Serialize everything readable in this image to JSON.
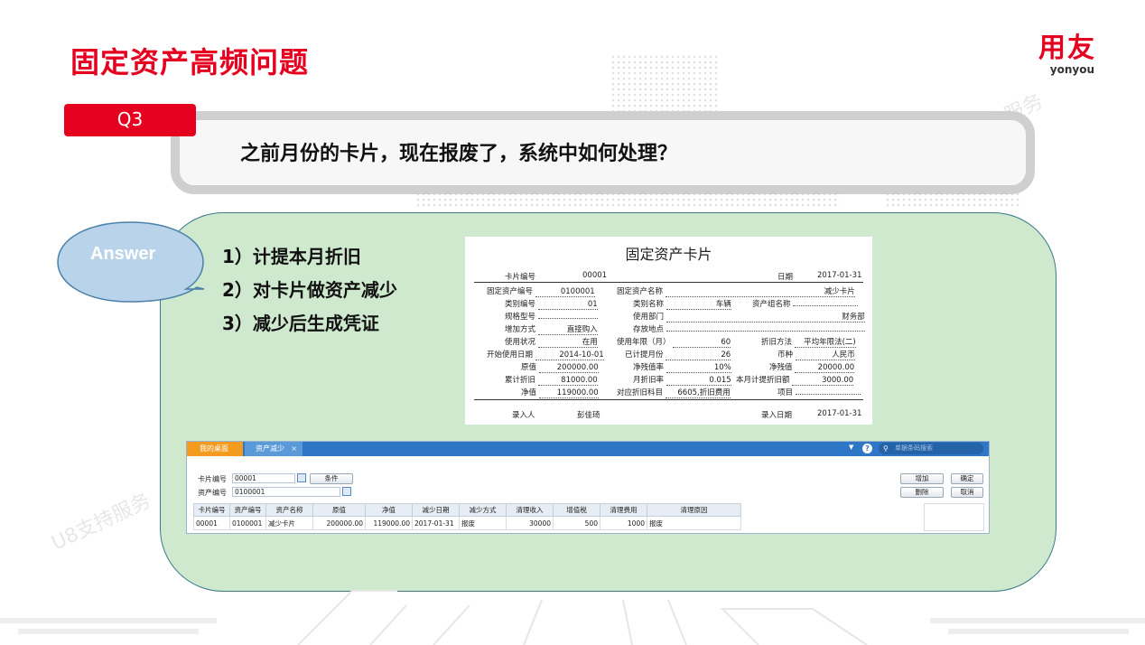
{
  "slide": {
    "title": "固定资产高频问题"
  },
  "logo": {
    "cn": "用友",
    "en": "yonyou"
  },
  "watermarks": [
    "U8支持服务",
    "U8支持服务",
    "U8支持服务"
  ],
  "question": {
    "tag": "Q3",
    "text": "之前月份的卡片，现在报废了，系统中如何处理？"
  },
  "answer": {
    "label": "Answer",
    "steps": [
      "1）计提本月折旧",
      "2）对卡片做资产减少",
      "3）减少后生成凭证"
    ]
  },
  "card": {
    "title": "固定资产卡片",
    "fields": {
      "card_no_l": "卡片编号",
      "card_no_v": "00001",
      "date_l": "日期",
      "date_v": "2017-01-31",
      "asset_no_l": "固定资产编号",
      "asset_no_v": "0100001",
      "asset_name_l": "固定资产名称",
      "asset_name_v": "减少卡片",
      "cat_no_l": "类别编号",
      "cat_no_v": "01",
      "cat_name_l": "类别名称",
      "cat_name_v": "车辆",
      "group_l": "资产组名称",
      "group_v": "",
      "spec_l": "规格型号",
      "spec_v": "",
      "dept_l": "使用部门",
      "dept_v": "财务部",
      "addway_l": "增加方式",
      "addway_v": "直接购入",
      "loc_l": "存放地点",
      "loc_v": "",
      "status_l": "使用状况",
      "status_v": "在用",
      "life_l": "使用年限（月）",
      "life_v": "60",
      "method_l": "折旧方法",
      "method_v": "平均年限法(二)",
      "start_l": "开始使用日期",
      "start_v": "2014-10-01",
      "accrued_l": "已计提月份",
      "accrued_v": "26",
      "cur_l": "币种",
      "cur_v": "人民币",
      "orig_l": "原值",
      "orig_v": "200000.00",
      "salrate_l": "净残值率",
      "salrate_v": "10%",
      "salval_l": "净残值",
      "salval_v": "20000.00",
      "accdep_l": "累计折旧",
      "accdep_v": "81000.00",
      "mrate_l": "月折旧率",
      "mrate_v": "0.015",
      "mdep_l": "本月计提折旧额",
      "mdep_v": "3000.00",
      "net_l": "净值",
      "net_v": "119000.00",
      "subject_l": "对应折旧科目",
      "subject_v": "6605,折旧费用",
      "item_l": "项目",
      "item_v": "",
      "entry_l": "录入人",
      "entry_v": "彭佳琦",
      "entrydate_l": "录入日期",
      "entrydate_v": "2017-01-31"
    }
  },
  "window": {
    "tab_home": "我的桌面",
    "tab_active": "资产减少",
    "tab_close": "×",
    "search_placeholder": "单据条码搜索",
    "card_no_label": "卡片编号",
    "card_no_value": "00001",
    "asset_no_label": "资产编号",
    "asset_no_value": "0100001",
    "condition_btn": "条件",
    "btn_add": "增加",
    "btn_ok": "确定",
    "btn_delete": "删除",
    "btn_cancel": "取消",
    "headers": [
      "卡片编号",
      "资产编号",
      "资产名称",
      "原值",
      "净值",
      "减少日期",
      "减少方式",
      "清理收入",
      "增值税",
      "清理费用",
      "清理原因"
    ],
    "row": [
      "00001",
      "0100001",
      "减少卡片",
      "200000.00",
      "119000.00",
      "2017-01-31",
      "报废",
      "30000",
      "500",
      "1000",
      "报废"
    ]
  },
  "colors": {
    "brand_red": "#e6001f",
    "panel_green": "#cfe9cf",
    "bubble_blue": "#b9d3ea",
    "window_blue": "#2e77c6"
  }
}
